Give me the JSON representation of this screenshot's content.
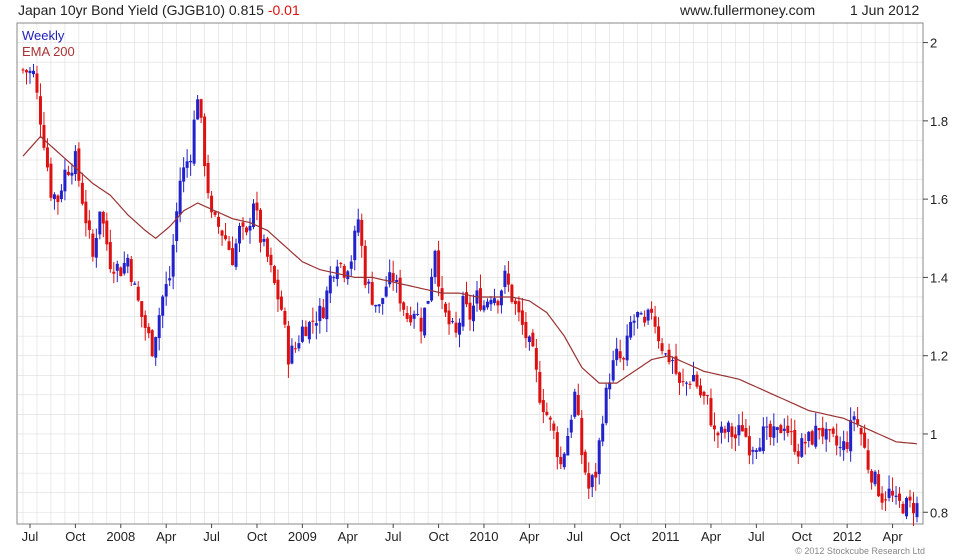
{
  "header": {
    "title": "Japan 10yr Bond Yield (GJGB10) 0.815",
    "change": "-0.01",
    "site": "www.fullermoney.com",
    "date": "1 Jun 2012"
  },
  "footer": {
    "copyright": "© 2012 Stockcube Research Ltd"
  },
  "colors": {
    "up": "#2222cc",
    "down": "#dd1111",
    "ema": "#993333",
    "grid": "#dddddd",
    "axis": "#888888"
  },
  "chart_data": {
    "type": "bar",
    "title": "Japan 10yr Bond Yield (GJGB10)",
    "ylim": [
      0.77,
      2.05
    ],
    "y_ticks": [
      0.8,
      1,
      1.2,
      1.4,
      1.6,
      1.8,
      2
    ],
    "y_tick_labels": [
      "0.8",
      "1",
      "1.2",
      "1.4",
      "1.6",
      "1.8",
      "2"
    ],
    "x_tick_labels": [
      "Jul",
      "Oct",
      "2008",
      "Apr",
      "Jul",
      "Oct",
      "2009",
      "Apr",
      "Jul",
      "Oct",
      "2010",
      "Apr",
      "Jul",
      "Oct",
      "2011",
      "Apr",
      "Jul",
      "Oct",
      "2012",
      "Apr"
    ],
    "x_tick_weeks": [
      2,
      15,
      28,
      41,
      54,
      67,
      80,
      93,
      106,
      119,
      132,
      145,
      158,
      171,
      184,
      197,
      210,
      223,
      236,
      249
    ],
    "grid": true,
    "legend": "top-left",
    "legend_entries": [
      "Weekly",
      "EMA 200"
    ],
    "series": [
      {
        "name": "Weekly",
        "style": "candlestick",
        "weeks_total": 257,
        "anchor_closes": [
          [
            0,
            1.93
          ],
          [
            3,
            1.92
          ],
          [
            6,
            1.75
          ],
          [
            8,
            1.62
          ],
          [
            10,
            1.6
          ],
          [
            12,
            1.67
          ],
          [
            15,
            1.7
          ],
          [
            18,
            1.55
          ],
          [
            20,
            1.45
          ],
          [
            22,
            1.58
          ],
          [
            25,
            1.44
          ],
          [
            28,
            1.42
          ],
          [
            30,
            1.45
          ],
          [
            32,
            1.37
          ],
          [
            34,
            1.3
          ],
          [
            37,
            1.22
          ],
          [
            40,
            1.35
          ],
          [
            42,
            1.4
          ],
          [
            45,
            1.65
          ],
          [
            48,
            1.72
          ],
          [
            50,
            1.87
          ],
          [
            52,
            1.7
          ],
          [
            54,
            1.55
          ],
          [
            56,
            1.53
          ],
          [
            58,
            1.5
          ],
          [
            60,
            1.45
          ],
          [
            62,
            1.52
          ],
          [
            64,
            1.5
          ],
          [
            66,
            1.6
          ],
          [
            68,
            1.5
          ],
          [
            70,
            1.45
          ],
          [
            72,
            1.38
          ],
          [
            74,
            1.32
          ],
          [
            76,
            1.2
          ],
          [
            78,
            1.22
          ],
          [
            80,
            1.27
          ],
          [
            82,
            1.28
          ],
          [
            84,
            1.3
          ],
          [
            86,
            1.32
          ],
          [
            88,
            1.4
          ],
          [
            90,
            1.45
          ],
          [
            92,
            1.42
          ],
          [
            94,
            1.45
          ],
          [
            96,
            1.55
          ],
          [
            98,
            1.4
          ],
          [
            100,
            1.35
          ],
          [
            102,
            1.32
          ],
          [
            104,
            1.38
          ],
          [
            106,
            1.4
          ],
          [
            108,
            1.35
          ],
          [
            110,
            1.3
          ],
          [
            112,
            1.32
          ],
          [
            114,
            1.28
          ],
          [
            116,
            1.35
          ],
          [
            118,
            1.48
          ],
          [
            120,
            1.32
          ],
          [
            122,
            1.28
          ],
          [
            124,
            1.25
          ],
          [
            126,
            1.33
          ],
          [
            128,
            1.3
          ],
          [
            130,
            1.35
          ],
          [
            132,
            1.33
          ],
          [
            134,
            1.36
          ],
          [
            136,
            1.35
          ],
          [
            138,
            1.4
          ],
          [
            140,
            1.35
          ],
          [
            142,
            1.3
          ],
          [
            144,
            1.25
          ],
          [
            146,
            1.2
          ],
          [
            148,
            1.1
          ],
          [
            150,
            1.05
          ],
          [
            152,
            1.0
          ],
          [
            154,
            0.92
          ],
          [
            156,
            1.0
          ],
          [
            158,
            1.1
          ],
          [
            160,
            0.95
          ],
          [
            162,
            0.86
          ],
          [
            164,
            0.9
          ],
          [
            166,
            1.05
          ],
          [
            168,
            1.15
          ],
          [
            170,
            1.2
          ],
          [
            172,
            1.18
          ],
          [
            174,
            1.28
          ],
          [
            176,
            1.3
          ],
          [
            178,
            1.27
          ],
          [
            180,
            1.32
          ],
          [
            182,
            1.25
          ],
          [
            184,
            1.2
          ],
          [
            186,
            1.19
          ],
          [
            188,
            1.12
          ],
          [
            190,
            1.13
          ],
          [
            192,
            1.15
          ],
          [
            194,
            1.1
          ],
          [
            196,
            1.08
          ],
          [
            198,
            1.0
          ],
          [
            200,
            1.0
          ],
          [
            202,
            1.01
          ],
          [
            204,
            0.99
          ],
          [
            206,
            1.02
          ],
          [
            208,
            0.97
          ],
          [
            210,
            0.98
          ],
          [
            212,
            1.0
          ],
          [
            214,
            0.99
          ],
          [
            216,
            1.0
          ],
          [
            218,
            1.03
          ],
          [
            220,
            0.99
          ],
          [
            222,
            0.96
          ],
          [
            224,
            0.98
          ],
          [
            226,
            0.99
          ],
          [
            228,
            1.02
          ],
          [
            230,
            0.99
          ],
          [
            232,
            0.98
          ],
          [
            234,
            0.96
          ],
          [
            236,
            0.98
          ],
          [
            238,
            1.05
          ],
          [
            240,
            1.0
          ],
          [
            242,
            0.92
          ],
          [
            244,
            0.88
          ],
          [
            246,
            0.84
          ],
          [
            248,
            0.85
          ],
          [
            250,
            0.82
          ],
          [
            256,
            0.815
          ]
        ]
      },
      {
        "name": "EMA 200",
        "style": "line",
        "anchors": [
          [
            0,
            1.71
          ],
          [
            5,
            1.76
          ],
          [
            10,
            1.72
          ],
          [
            15,
            1.68
          ],
          [
            20,
            1.64
          ],
          [
            25,
            1.61
          ],
          [
            30,
            1.56
          ],
          [
            35,
            1.52
          ],
          [
            38,
            1.5
          ],
          [
            42,
            1.53
          ],
          [
            46,
            1.57
          ],
          [
            50,
            1.59
          ],
          [
            55,
            1.57
          ],
          [
            60,
            1.55
          ],
          [
            65,
            1.54
          ],
          [
            70,
            1.52
          ],
          [
            75,
            1.48
          ],
          [
            80,
            1.44
          ],
          [
            85,
            1.42
          ],
          [
            90,
            1.41
          ],
          [
            95,
            1.4
          ],
          [
            100,
            1.4
          ],
          [
            105,
            1.39
          ],
          [
            110,
            1.38
          ],
          [
            115,
            1.37
          ],
          [
            120,
            1.36
          ],
          [
            125,
            1.36
          ],
          [
            130,
            1.35
          ],
          [
            135,
            1.35
          ],
          [
            140,
            1.35
          ],
          [
            145,
            1.34
          ],
          [
            150,
            1.31
          ],
          [
            155,
            1.25
          ],
          [
            160,
            1.17
          ],
          [
            165,
            1.13
          ],
          [
            170,
            1.13
          ],
          [
            175,
            1.16
          ],
          [
            180,
            1.19
          ],
          [
            185,
            1.2
          ],
          [
            190,
            1.18
          ],
          [
            195,
            1.16
          ],
          [
            200,
            1.15
          ],
          [
            205,
            1.14
          ],
          [
            210,
            1.12
          ],
          [
            215,
            1.1
          ],
          [
            220,
            1.08
          ],
          [
            225,
            1.06
          ],
          [
            230,
            1.05
          ],
          [
            235,
            1.04
          ],
          [
            240,
            1.02
          ],
          [
            245,
            1.0
          ],
          [
            250,
            0.98
          ],
          [
            256,
            0.975
          ]
        ]
      }
    ]
  }
}
